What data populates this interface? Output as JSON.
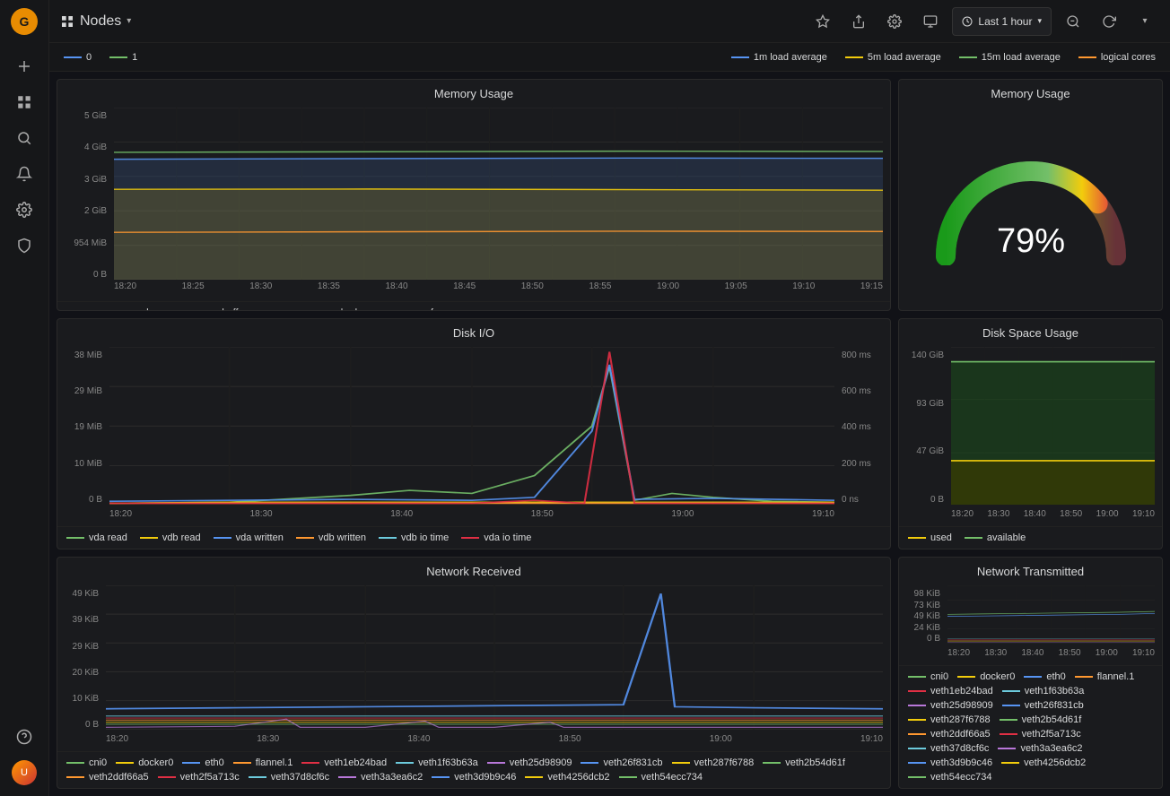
{
  "sidebar": {
    "logo_text": "G",
    "items": [
      {
        "name": "add-icon",
        "label": "+"
      },
      {
        "name": "dashboard-icon",
        "label": "⊞"
      },
      {
        "name": "explore-icon",
        "label": "✦"
      },
      {
        "name": "alert-icon",
        "label": "🔔"
      },
      {
        "name": "settings-icon",
        "label": "⚙"
      },
      {
        "name": "shield-icon",
        "label": "🛡"
      },
      {
        "name": "help-icon",
        "label": "?"
      },
      {
        "name": "user-icon",
        "label": "U"
      }
    ]
  },
  "topbar": {
    "grid_icon": "⊞",
    "title": "Nodes",
    "dropdown_arrow": "▾",
    "star_label": "★",
    "share_label": "↗",
    "settings_label": "⚙",
    "monitor_label": "🖥",
    "time_label": "Last 1 hour",
    "zoom_label": "🔍",
    "refresh_label": "↻",
    "more_label": "▾"
  },
  "legend_top": {
    "items": [
      {
        "color": "#5794f2",
        "label": "0"
      },
      {
        "color": "#73bf69",
        "label": "1"
      },
      {
        "spacer": true
      },
      {
        "color": "#5794f2",
        "label": "1m load average"
      },
      {
        "color": "#f2cc0c",
        "label": "5m load average"
      },
      {
        "color": "#73bf69",
        "label": "15m load average"
      },
      {
        "color": "#ff9830",
        "label": "logical cores"
      }
    ]
  },
  "memory_usage_chart": {
    "title": "Memory Usage",
    "y_labels": [
      "5 GiB",
      "4 GiB",
      "3 GiB",
      "2 GiB",
      "954 MiB",
      "0 B"
    ],
    "x_labels": [
      "18:20",
      "18:25",
      "18:30",
      "18:35",
      "18:40",
      "18:45",
      "18:50",
      "18:55",
      "19:00",
      "19:05",
      "19:10",
      "19:15"
    ],
    "legend": [
      {
        "color": "#73bf69",
        "label": "memory used"
      },
      {
        "color": "#f2cc0c",
        "label": "memory buffers"
      },
      {
        "color": "#5794f2",
        "label": "memory cached"
      },
      {
        "color": "#ff9830",
        "label": "memory free"
      }
    ]
  },
  "gauge": {
    "title": "Memory Usage",
    "value": "79%",
    "percent": 79
  },
  "diskio_chart": {
    "title": "Disk I/O",
    "y_labels_left": [
      "38 MiB",
      "29 MiB",
      "19 MiB",
      "10 MiB",
      "0 B"
    ],
    "y_labels_right": [
      "800 ms",
      "600 ms",
      "400 ms",
      "200 ms",
      "0 ns"
    ],
    "x_labels": [
      "18:20",
      "18:30",
      "18:40",
      "18:50",
      "19:00",
      "19:10"
    ],
    "legend": [
      {
        "color": "#73bf69",
        "label": "vda read"
      },
      {
        "color": "#f2cc0c",
        "label": "vdb read"
      },
      {
        "color": "#5794f2",
        "label": "vda written"
      },
      {
        "color": "#ff9830",
        "label": "vdb written"
      },
      {
        "color": "#6ccadc",
        "label": "vdb io time"
      },
      {
        "color": "#e02f44",
        "label": "vda io time"
      }
    ]
  },
  "diskspace_chart": {
    "title": "Disk Space Usage",
    "y_labels": [
      "140 GiB",
      "93 GiB",
      "47 GiB",
      "0 B"
    ],
    "x_labels": [
      "18:20",
      "18:30",
      "18:40",
      "18:50",
      "19:00",
      "19:10"
    ],
    "legend": [
      {
        "color": "#f2cc0c",
        "label": "used"
      },
      {
        "color": "#73bf69",
        "label": "available"
      }
    ]
  },
  "netrecv_chart": {
    "title": "Network Received",
    "y_labels": [
      "49 KiB",
      "39 KiB",
      "29 KiB",
      "20 KiB",
      "10 KiB",
      "0 B"
    ],
    "x_labels": [
      "18:20",
      "18:30",
      "18:40",
      "18:50",
      "19:00",
      "19:10"
    ],
    "legend": [
      {
        "color": "#73bf69",
        "label": "cni0"
      },
      {
        "color": "#f2cc0c",
        "label": "docker0"
      },
      {
        "color": "#5794f2",
        "label": "eth0"
      },
      {
        "color": "#ff9830",
        "label": "flannel.1"
      },
      {
        "color": "#e02f44",
        "label": "veth1eb24bad"
      },
      {
        "color": "#6ccadc",
        "label": "veth1f63b63a"
      },
      {
        "color": "#b877d9",
        "label": "veth25d98909"
      },
      {
        "color": "#5794f2",
        "label": "veth26f831cb"
      },
      {
        "color": "#f2cc0c",
        "label": "veth287f6788"
      },
      {
        "color": "#73bf69",
        "label": "veth2b54d61f"
      },
      {
        "color": "#ff9830",
        "label": "veth2ddf66a5"
      },
      {
        "color": "#e02f44",
        "label": "veth2f5a713c"
      },
      {
        "color": "#6ccadc",
        "label": "veth37d8cf6c"
      },
      {
        "color": "#b877d9",
        "label": "veth3a3ea6c2"
      },
      {
        "color": "#5794f2",
        "label": "veth3d9b9c46"
      },
      {
        "color": "#f2cc0c",
        "label": "veth4256dcb2"
      },
      {
        "color": "#73bf69",
        "label": "veth54ecc734"
      }
    ]
  },
  "nettrans_chart": {
    "title": "Network Transmitted",
    "y_labels": [
      "98 KiB",
      "73 KiB",
      "49 KiB",
      "24 KiB",
      "0 B"
    ],
    "x_labels": [
      "18:20",
      "18:30",
      "18:40",
      "18:50",
      "19:00",
      "19:10"
    ],
    "legend": [
      {
        "color": "#73bf69",
        "label": "cni0"
      },
      {
        "color": "#f2cc0c",
        "label": "docker0"
      },
      {
        "color": "#5794f2",
        "label": "eth0"
      },
      {
        "color": "#ff9830",
        "label": "flannel.1"
      },
      {
        "color": "#e02f44",
        "label": "veth1eb24bad"
      },
      {
        "color": "#6ccadc",
        "label": "veth1f63b63a"
      },
      {
        "color": "#b877d9",
        "label": "veth25d98909"
      },
      {
        "color": "#5794f2",
        "label": "veth26f831cb"
      },
      {
        "color": "#f2cc0c",
        "label": "veth287f6788"
      },
      {
        "color": "#73bf69",
        "label": "veth2b54d61f"
      },
      {
        "color": "#ff9830",
        "label": "veth2ddf66a5"
      },
      {
        "color": "#e02f44",
        "label": "veth2f5a713c"
      },
      {
        "color": "#6ccadc",
        "label": "veth37d8cf6c"
      },
      {
        "color": "#b877d9",
        "label": "veth3a3ea6c2"
      },
      {
        "color": "#5794f2",
        "label": "veth3d9b9c46"
      },
      {
        "color": "#f2cc0c",
        "label": "veth4256dcb2"
      },
      {
        "color": "#73bf69",
        "label": "veth54ecc734"
      }
    ]
  }
}
